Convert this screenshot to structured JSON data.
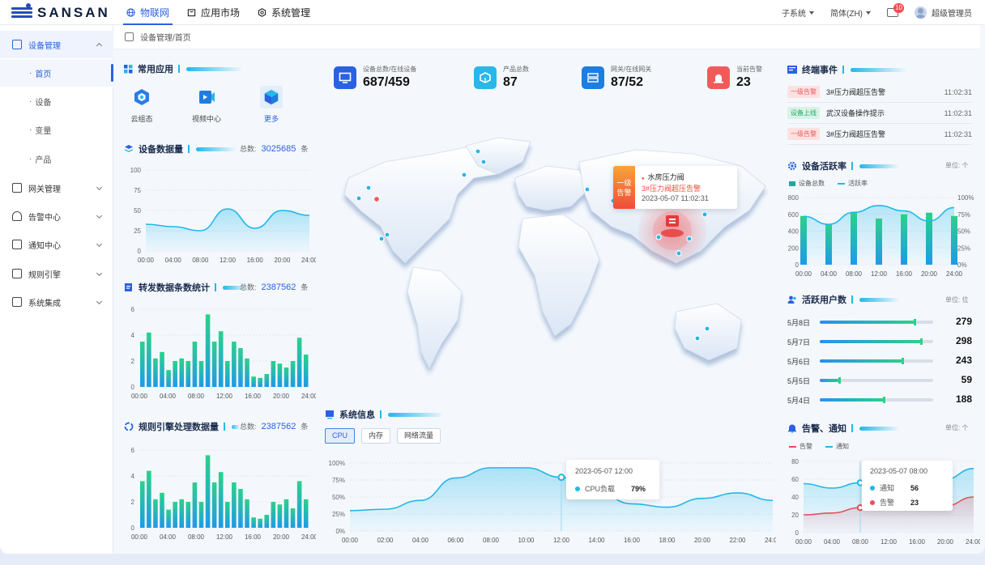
{
  "brand": {
    "name": "SANSAN"
  },
  "topnav": [
    {
      "label": "物联网",
      "icon": "globe-icon",
      "active": true
    },
    {
      "label": "应用市场",
      "icon": "store-icon",
      "active": false
    },
    {
      "label": "系统管理",
      "icon": "settings-icon",
      "active": false
    }
  ],
  "topright": {
    "subsystem": "子系统",
    "language": "简体(ZH)",
    "messages_badge": "10",
    "user": "超级管理员"
  },
  "sidebar": {
    "device_mgmt": "设备管理",
    "subs": [
      "首页",
      "设备",
      "变量",
      "产品"
    ],
    "active_sub": 0,
    "items": [
      "网关管理",
      "告警中心",
      "通知中心",
      "规则引擎",
      "系统集成"
    ]
  },
  "breadcrumb": "设备管理/首页",
  "common_apps": {
    "title": "常用应用",
    "apps": [
      {
        "label": "云组态",
        "icon": "cloud-config-icon"
      },
      {
        "label": "视频中心",
        "icon": "video-icon"
      },
      {
        "label": "更多",
        "icon": "cube-icon"
      }
    ]
  },
  "device_data": {
    "title": "设备数据量",
    "total_label": "总数:",
    "total": "3025685",
    "unit": "条"
  },
  "forward_stats": {
    "title": "转发数据条数统计",
    "total_label": "总数:",
    "total": "2387562",
    "unit": "条"
  },
  "rule_engine": {
    "title": "规则引擎处理数据量",
    "total_label": "总数:",
    "total": "2387562",
    "unit": "条"
  },
  "stats": [
    {
      "label": "设备总数/在线设备",
      "value": "687/459",
      "color": "#2a61e0",
      "icon": "monitor-icon"
    },
    {
      "label": "产品总数",
      "value": "87",
      "color": "#29b6e8",
      "icon": "box-icon"
    },
    {
      "label": "网关/在线网关",
      "value": "87/52",
      "color": "#1e7de0",
      "icon": "gateway-icon"
    },
    {
      "label": "当前告警",
      "value": "23",
      "color": "#f25a5a",
      "icon": "alarm-light-icon"
    }
  ],
  "map_popup": {
    "tag": "一级告警",
    "name": "水房压力阀",
    "alarm": "3#压力阀超压告警",
    "time": "2023-05-07  11:02:31"
  },
  "system_info": {
    "title": "系统信息",
    "tabs": [
      "CPU",
      "内存",
      "网络流量"
    ],
    "active_tab": 0,
    "tooltip": {
      "time": "2023-05-07  12:00",
      "label": "CPU负载",
      "value": "79%"
    }
  },
  "terminal_events": {
    "title": "终端事件",
    "rows": [
      {
        "tag": "一级告警",
        "tag_color": "red",
        "text": "3#压力阀超压告警",
        "time": "11:02:31"
      },
      {
        "tag": "设备上线",
        "tag_color": "green",
        "text": "武汉设备操作提示",
        "time": "11:02:31"
      },
      {
        "tag": "一级告警",
        "tag_color": "red",
        "text": "3#压力阀超压告警",
        "time": "11:02:31"
      }
    ]
  },
  "activity": {
    "title": "设备活跃率",
    "unit_label": "单位: 个",
    "legend": [
      "设备总数",
      "活跃率"
    ]
  },
  "active_users": {
    "title": "活跃用户数",
    "unit_label": "单位: 位",
    "rows": [
      {
        "label": "5月8日",
        "value": 279
      },
      {
        "label": "5月7日",
        "value": 298
      },
      {
        "label": "5月6日",
        "value": 243
      },
      {
        "label": "5月5日",
        "value": 59
      },
      {
        "label": "5月4日",
        "value": 188
      }
    ]
  },
  "alerts_notice": {
    "title": "告警、通知",
    "unit_label": "单位: 个",
    "legend": [
      "告警",
      "通知"
    ],
    "tooltip": {
      "time": "2023-05-07  08:00",
      "s1": "通知",
      "v1": "56",
      "s2": "告警",
      "v2": "23"
    }
  },
  "chart_data": [
    {
      "id": "device-data",
      "type": "area",
      "x": [
        "00:00",
        "04:00",
        "08:00",
        "12:00",
        "16:00",
        "20:00",
        "24:00"
      ],
      "ylim": [
        0,
        100
      ],
      "yticks": [
        0,
        25,
        50,
        75,
        100
      ],
      "series": [
        {
          "values": [
            33,
            30,
            25,
            52,
            28,
            50,
            44
          ]
        }
      ]
    },
    {
      "id": "forward-stats",
      "type": "bar",
      "x": [
        "00:00",
        "04:00",
        "08:00",
        "12:00",
        "16:00",
        "20:00",
        "24:00"
      ],
      "ylim": [
        0,
        6
      ],
      "yticks": [
        0,
        2,
        4,
        6
      ],
      "series": [
        {
          "values": [
            3.5,
            4.2,
            2.2,
            2.7,
            1.3,
            2.0,
            2.2,
            2.0,
            3.5,
            2.0,
            5.6,
            3.5,
            4.3,
            2.0,
            3.5,
            3.0,
            2.2,
            0.8,
            0.7,
            1.0,
            2.0,
            1.8,
            1.5,
            2.0,
            3.8,
            2.5
          ]
        }
      ]
    },
    {
      "id": "rule-engine",
      "type": "bar",
      "x": [
        "00:00",
        "04:00",
        "08:00",
        "12:00",
        "16:00",
        "20:00",
        "24:00"
      ],
      "ylim": [
        0,
        6
      ],
      "yticks": [
        0,
        2,
        4,
        6
      ],
      "series": [
        {
          "values": [
            3.6,
            4.4,
            2.2,
            2.7,
            1.4,
            2.0,
            2.2,
            2.0,
            3.5,
            2.0,
            5.6,
            3.5,
            4.3,
            2.0,
            3.5,
            3.0,
            2.2,
            0.8,
            0.7,
            1.0,
            2.0,
            1.8,
            2.2,
            1.5,
            3.6,
            2.2
          ]
        }
      ]
    },
    {
      "id": "system-info",
      "type": "area",
      "x": [
        "00:00",
        "02:00",
        "04:00",
        "06:00",
        "08:00",
        "10:00",
        "12:00",
        "14:00",
        "16:00",
        "18:00",
        "20:00",
        "22:00",
        "24:00"
      ],
      "ylim": [
        0,
        100
      ],
      "yticks": [
        "0%",
        "25%",
        "50%",
        "75%",
        "100%"
      ],
      "series": [
        {
          "name": "CPU负载",
          "values": [
            30,
            32,
            45,
            78,
            93,
            93,
            79,
            58,
            40,
            35,
            48,
            56,
            45
          ]
        }
      ]
    },
    {
      "id": "activity",
      "type": "bar",
      "categories": [
        "00:00",
        "04:00",
        "08:00",
        "12:00",
        "16:00",
        "20:00",
        "24:00"
      ],
      "ylim": [
        0,
        800
      ],
      "yticks": [
        0,
        200,
        400,
        600,
        800
      ],
      "y2lim": [
        0,
        100
      ],
      "y2ticks": [
        "0%",
        "25%",
        "50%",
        "75%",
        "100%"
      ],
      "series": [
        {
          "name": "设备总数",
          "type": "bar",
          "values": [
            580,
            480,
            620,
            550,
            600,
            620,
            580
          ]
        },
        {
          "name": "活跃率",
          "type": "area",
          "values": [
            72,
            60,
            78,
            88,
            80,
            65,
            85
          ]
        }
      ]
    },
    {
      "id": "alerts-notice",
      "type": "line",
      "x": [
        "00:00",
        "04:00",
        "08:00",
        "12:00",
        "16:00",
        "20:00",
        "24:00"
      ],
      "ylim": [
        0,
        80
      ],
      "yticks": [
        0,
        20,
        40,
        60,
        80
      ],
      "series": [
        {
          "name": "通知",
          "values": [
            55,
            50,
            56,
            68,
            68,
            60,
            72
          ]
        },
        {
          "name": "告警",
          "values": [
            20,
            22,
            28,
            40,
            38,
            30,
            40
          ]
        }
      ]
    }
  ]
}
